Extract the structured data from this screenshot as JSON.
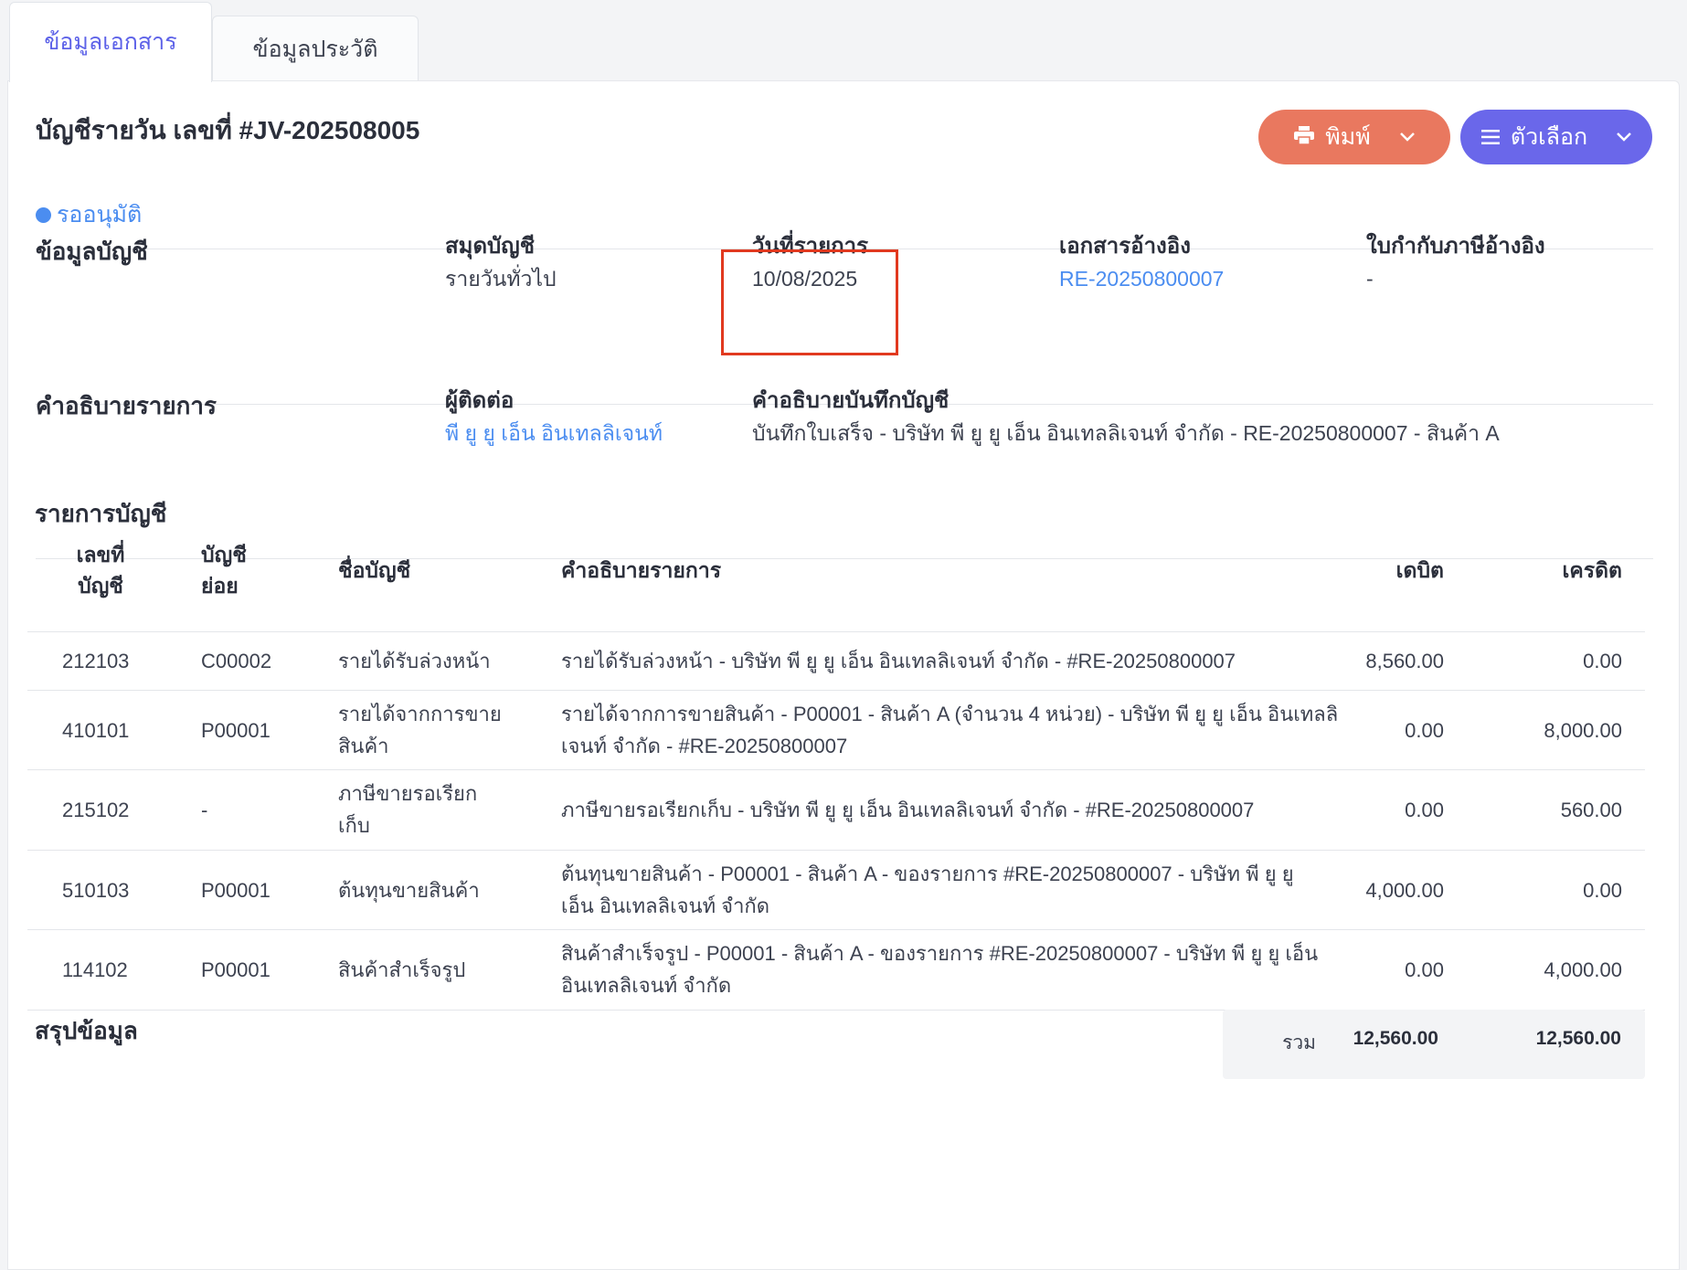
{
  "tabs": [
    {
      "label": "ข้อมูลเอกสาร"
    },
    {
      "label": "ข้อมูลประวัติ"
    }
  ],
  "header": {
    "title": "บัญชีรายวัน เลขที่ #JV-202508005",
    "print_label": "พิมพ์",
    "options_label": "ตัวเลือก",
    "status": "รออนุมัติ"
  },
  "account_info": {
    "section_label": "ข้อมูลบัญชี",
    "journal_book": {
      "label": "สมุดบัญชี",
      "value": "รายวันทั่วไป"
    },
    "transaction_date": {
      "label": "วันที่รายการ",
      "value": "10/08/2025"
    },
    "reference_doc": {
      "label": "เอกสารอ้างอิง",
      "value": "RE-20250800007"
    },
    "tax_invoice_ref": {
      "label": "ใบกำกับภาษีอ้างอิง",
      "value": "-"
    }
  },
  "description": {
    "section_label": "คำอธิบายรายการ",
    "contact": {
      "label": "ผู้ติดต่อ",
      "value": "พี ยู ยู เอ็น อินเทลลิเจนท์"
    },
    "journal_note": {
      "label": "คำอธิบายบันทึกบัญชี",
      "value": "บันทึกใบเสร็จ - บริษัท พี ยู ยู เอ็น อินเทลลิเจนท์ จำกัด - RE-20250800007 - สินค้า A"
    }
  },
  "entries": {
    "title": "รายการบัญชี",
    "columns": {
      "account_no_1": "เลขที่",
      "account_no_2": "บัญชี",
      "sub_account_1": "บัญชี",
      "sub_account_2": "ย่อย",
      "account_name": "ชื่อบัญชี",
      "description": "คำอธิบายรายการ",
      "debit": "เดบิต",
      "credit": "เครดิต"
    },
    "rows": [
      {
        "account_no": "212103",
        "sub": "C00002",
        "name1": "รายได้รับล่วงหน้า",
        "name2": "",
        "desc1": "รายได้รับล่วงหน้า - บริษัท พี ยู ยู เอ็น อินเทลลิเจนท์ จำกัด - #RE-20250800007",
        "desc2": "",
        "debit": "8,560.00",
        "credit": "0.00"
      },
      {
        "account_no": "410101",
        "sub": "P00001",
        "name1": "รายได้จากการขาย",
        "name2": "สินค้า",
        "desc1": "รายได้จากการขายสินค้า - P00001 - สินค้า A (จำนวน 4 หน่วย) - บริษัท พี ยู ยู เอ็น อินเทลลิ",
        "desc2": "เจนท์ จำกัด - #RE-20250800007",
        "debit": "0.00",
        "credit": "8,000.00"
      },
      {
        "account_no": "215102",
        "sub": "-",
        "name1": "ภาษีขายรอเรียก",
        "name2": "เก็บ",
        "desc1": "ภาษีขายรอเรียกเก็บ - บริษัท พี ยู ยู เอ็น อินเทลลิเจนท์ จำกัด - #RE-20250800007",
        "desc2": "",
        "debit": "0.00",
        "credit": "560.00"
      },
      {
        "account_no": "510103",
        "sub": "P00001",
        "name1": "ต้นทุนขายสินค้า",
        "name2": "",
        "desc1": "ต้นทุนขายสินค้า - P00001 - สินค้า A - ของรายการ #RE-20250800007 - บริษัท พี ยู ยู",
        "desc2": "เอ็น อินเทลลิเจนท์ จำกัด",
        "debit": "4,000.00",
        "credit": "0.00"
      },
      {
        "account_no": "114102",
        "sub": "P00001",
        "name1": "สินค้าสำเร็จรูป",
        "name2": "",
        "desc1": "สินค้าสำเร็จรูป - P00001 - สินค้า A - ของรายการ #RE-20250800007 - บริษัท พี ยู ยู เอ็น",
        "desc2": "อินเทลลิเจนท์ จำกัด",
        "debit": "0.00",
        "credit": "4,000.00"
      }
    ]
  },
  "summary": {
    "title": "สรุปข้อมูล",
    "total_label": "รวม",
    "total_debit": "12,560.00",
    "total_credit": "12,560.00"
  },
  "colors": {
    "accent": "#5d62e8",
    "print_button": "#e9785f",
    "options_button": "#6a67ea",
    "link": "#4b8df0",
    "highlight_box": "#e1391f"
  },
  "icons": {
    "print": "printer-icon",
    "options": "menu-lines-icon",
    "dropdown": "chevron-down-icon",
    "status": "status-dot-icon"
  }
}
